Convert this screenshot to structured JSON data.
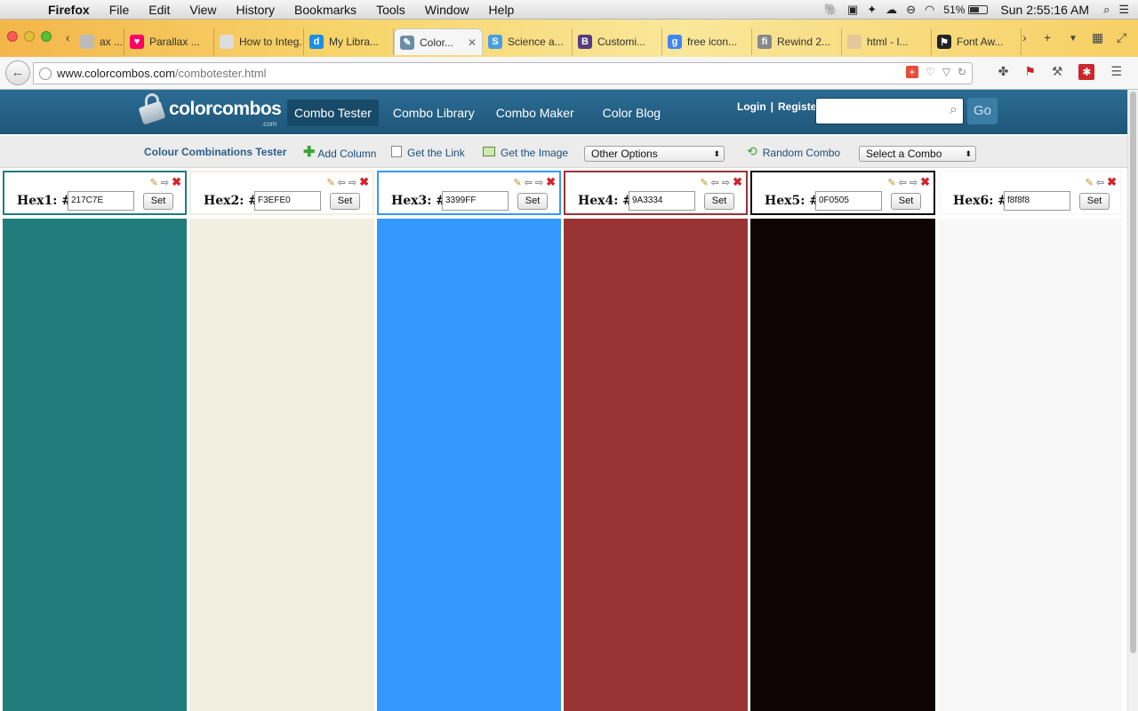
{
  "menubar": {
    "app": "Firefox",
    "items": [
      "File",
      "Edit",
      "View",
      "History",
      "Bookmarks",
      "Tools",
      "Window",
      "Help"
    ],
    "battery": "51%",
    "clock": "Sun 2:55:16 AM"
  },
  "tabs": [
    {
      "label": "ax ...",
      "fav_color": "#bbb",
      "fav_glyph": ""
    },
    {
      "label": "Parallax ...",
      "fav_color": "#f06",
      "fav_glyph": "♥"
    },
    {
      "label": "How to Integ...",
      "fav_color": "#ddd",
      "fav_glyph": ""
    },
    {
      "label": "My Libra...",
      "fav_color": "#1a8fe3",
      "fav_glyph": "d"
    },
    {
      "label": "Color...",
      "fav_color": "#6a8ea6",
      "fav_glyph": "✎",
      "active": true
    },
    {
      "label": "Science a...",
      "fav_color": "#4a9de0",
      "fav_glyph": "S"
    },
    {
      "label": "Customi...",
      "fav_color": "#563d7c",
      "fav_glyph": "B"
    },
    {
      "label": "free icon...",
      "fav_color": "#4285f4",
      "fav_glyph": "g"
    },
    {
      "label": "Rewind 2...",
      "fav_color": "#888",
      "fav_glyph": "fi"
    },
    {
      "label": "html - I...",
      "fav_color": "#e3c89a",
      "fav_glyph": ""
    },
    {
      "label": "Font Aw...",
      "fav_color": "#222",
      "fav_glyph": "⚑"
    }
  ],
  "url": {
    "host": "www.colorcombos.com",
    "path": "/combotester.html"
  },
  "site": {
    "logo": "colorcombos",
    "logo_sub": ".com",
    "nav": [
      "Combo Tester",
      "Combo Library",
      "Combo Maker",
      "Color Blog"
    ],
    "login": "Login",
    "register": "Register",
    "search_placeholder": "",
    "go": "Go"
  },
  "toolbar": {
    "title": "Colour Combinations Tester",
    "add_column": "Add Column",
    "get_link": "Get the Link",
    "get_image": "Get the Image",
    "other_options": "Other Options",
    "random_combo": "Random Combo",
    "select_combo": "Select a Combo"
  },
  "columns": [
    {
      "label": "Hex1: #",
      "hex": "217C7E",
      "color": "#217C7E",
      "border": "#217C7E"
    },
    {
      "label": "Hex2: #",
      "hex": "F3EFE0",
      "color": "#F3EFE0",
      "border": "#F3EFE0"
    },
    {
      "label": "Hex3: #",
      "hex": "3399FF",
      "color": "#3399FF",
      "border": "#3399FF"
    },
    {
      "label": "Hex4: #",
      "hex": "9A3334",
      "color": "#9A3334",
      "border": "#9A3334"
    },
    {
      "label": "Hex5: #",
      "hex": "0F0505",
      "color": "#0F0505",
      "border": "#0F0505"
    },
    {
      "label": "Hex6: #",
      "hex": "f8f8f8",
      "color": "#f8f8f8",
      "border": "#f8f8f8"
    }
  ],
  "set_label": "Set"
}
